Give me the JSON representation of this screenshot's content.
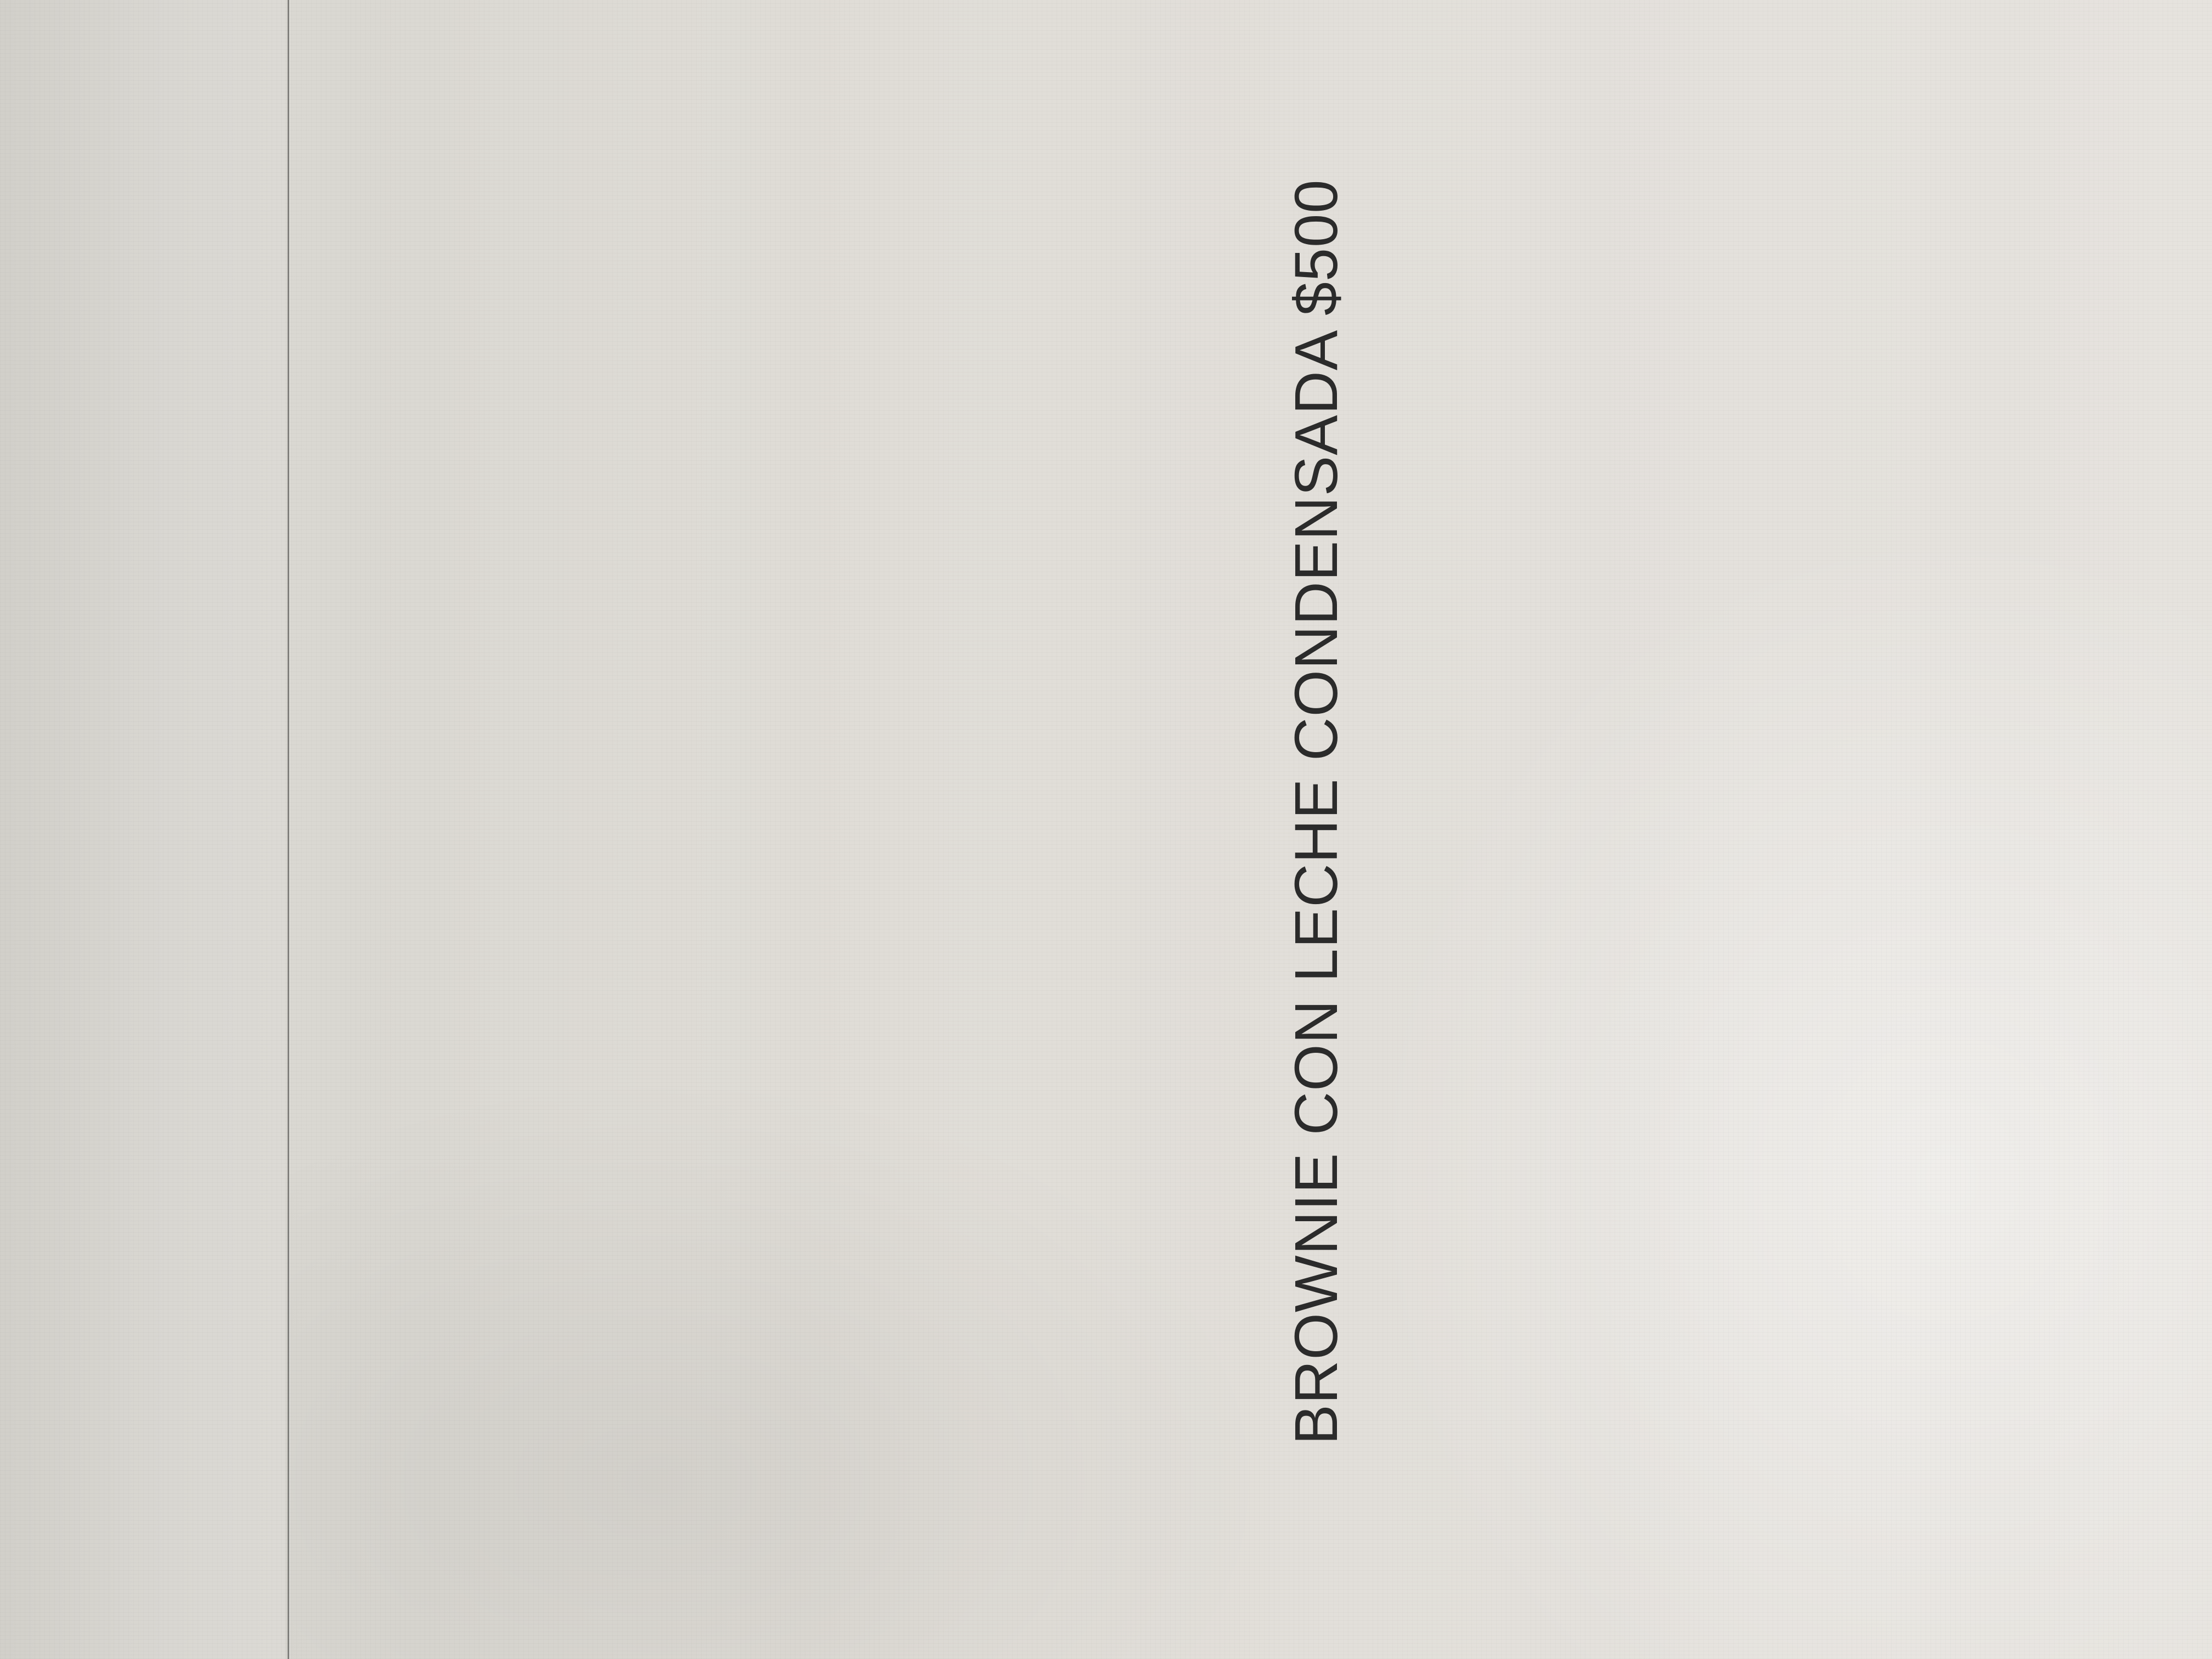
{
  "document": {
    "caption": "BROWNIE CON LECHE CONDENSADA $500",
    "colors": {
      "paper": "#e0ddd7",
      "text": "#2b2b2b"
    }
  }
}
